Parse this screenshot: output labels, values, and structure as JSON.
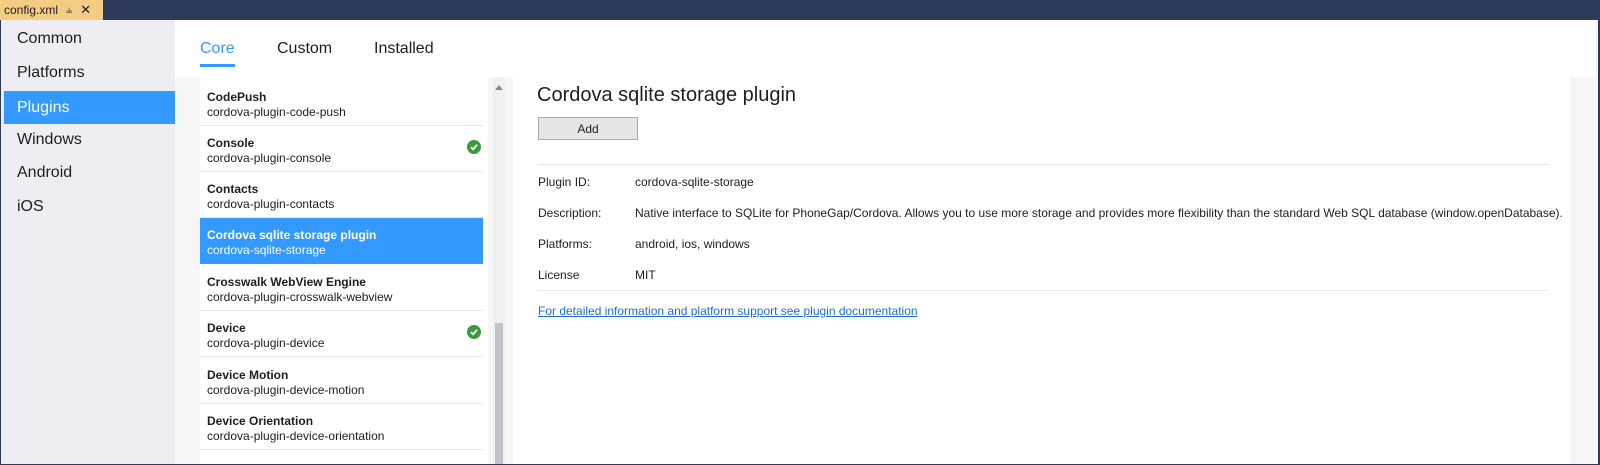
{
  "document_tab": {
    "label": "config.xml",
    "pin_icon": "pin-icon",
    "close_icon": "close-icon"
  },
  "nav": {
    "items": [
      {
        "label": "Common",
        "active": false
      },
      {
        "label": "Platforms",
        "active": false
      },
      {
        "label": "Plugins",
        "active": true
      },
      {
        "label": "Windows",
        "active": false
      },
      {
        "label": "Android",
        "active": false
      },
      {
        "label": "iOS",
        "active": false
      }
    ]
  },
  "tabs": [
    {
      "label": "Core",
      "active": true
    },
    {
      "label": "Custom",
      "active": false
    },
    {
      "label": "Installed",
      "active": false
    }
  ],
  "plugins": [
    {
      "name": "CodePush",
      "id": "cordova-plugin-code-push",
      "installed": false,
      "selected": false
    },
    {
      "name": "Console",
      "id": "cordova-plugin-console",
      "installed": true,
      "selected": false
    },
    {
      "name": "Contacts",
      "id": "cordova-plugin-contacts",
      "installed": false,
      "selected": false
    },
    {
      "name": "Cordova sqlite storage plugin",
      "id": "cordova-sqlite-storage",
      "installed": false,
      "selected": true
    },
    {
      "name": "Crosswalk WebView Engine",
      "id": "cordova-plugin-crosswalk-webview",
      "installed": false,
      "selected": false
    },
    {
      "name": "Device",
      "id": "cordova-plugin-device",
      "installed": true,
      "selected": false
    },
    {
      "name": "Device Motion",
      "id": "cordova-plugin-device-motion",
      "installed": false,
      "selected": false
    },
    {
      "name": "Device Orientation",
      "id": "cordova-plugin-device-orientation",
      "installed": false,
      "selected": false
    }
  ],
  "detail": {
    "title": "Cordova sqlite storage plugin",
    "add_label": "Add",
    "plugin_id_label": "Plugin ID:",
    "plugin_id": "cordova-sqlite-storage",
    "description_label": "Description:",
    "description": "Native interface to SQLite for PhoneGap/Cordova. Allows you to use more storage and provides more flexibility than the standard Web SQL database (window.openDatabase).",
    "platforms_label": "Platforms:",
    "platforms": "android, ios, windows",
    "license_label": "License",
    "license": "MIT",
    "doc_link": "For detailed information and platform support see plugin documentation"
  },
  "colors": {
    "accent": "#3399ff",
    "title_bar": "#2d3a5a",
    "doc_tab": "#f5cc84",
    "installed_check": "#3c9a3c",
    "link": "#1e6ed0"
  }
}
